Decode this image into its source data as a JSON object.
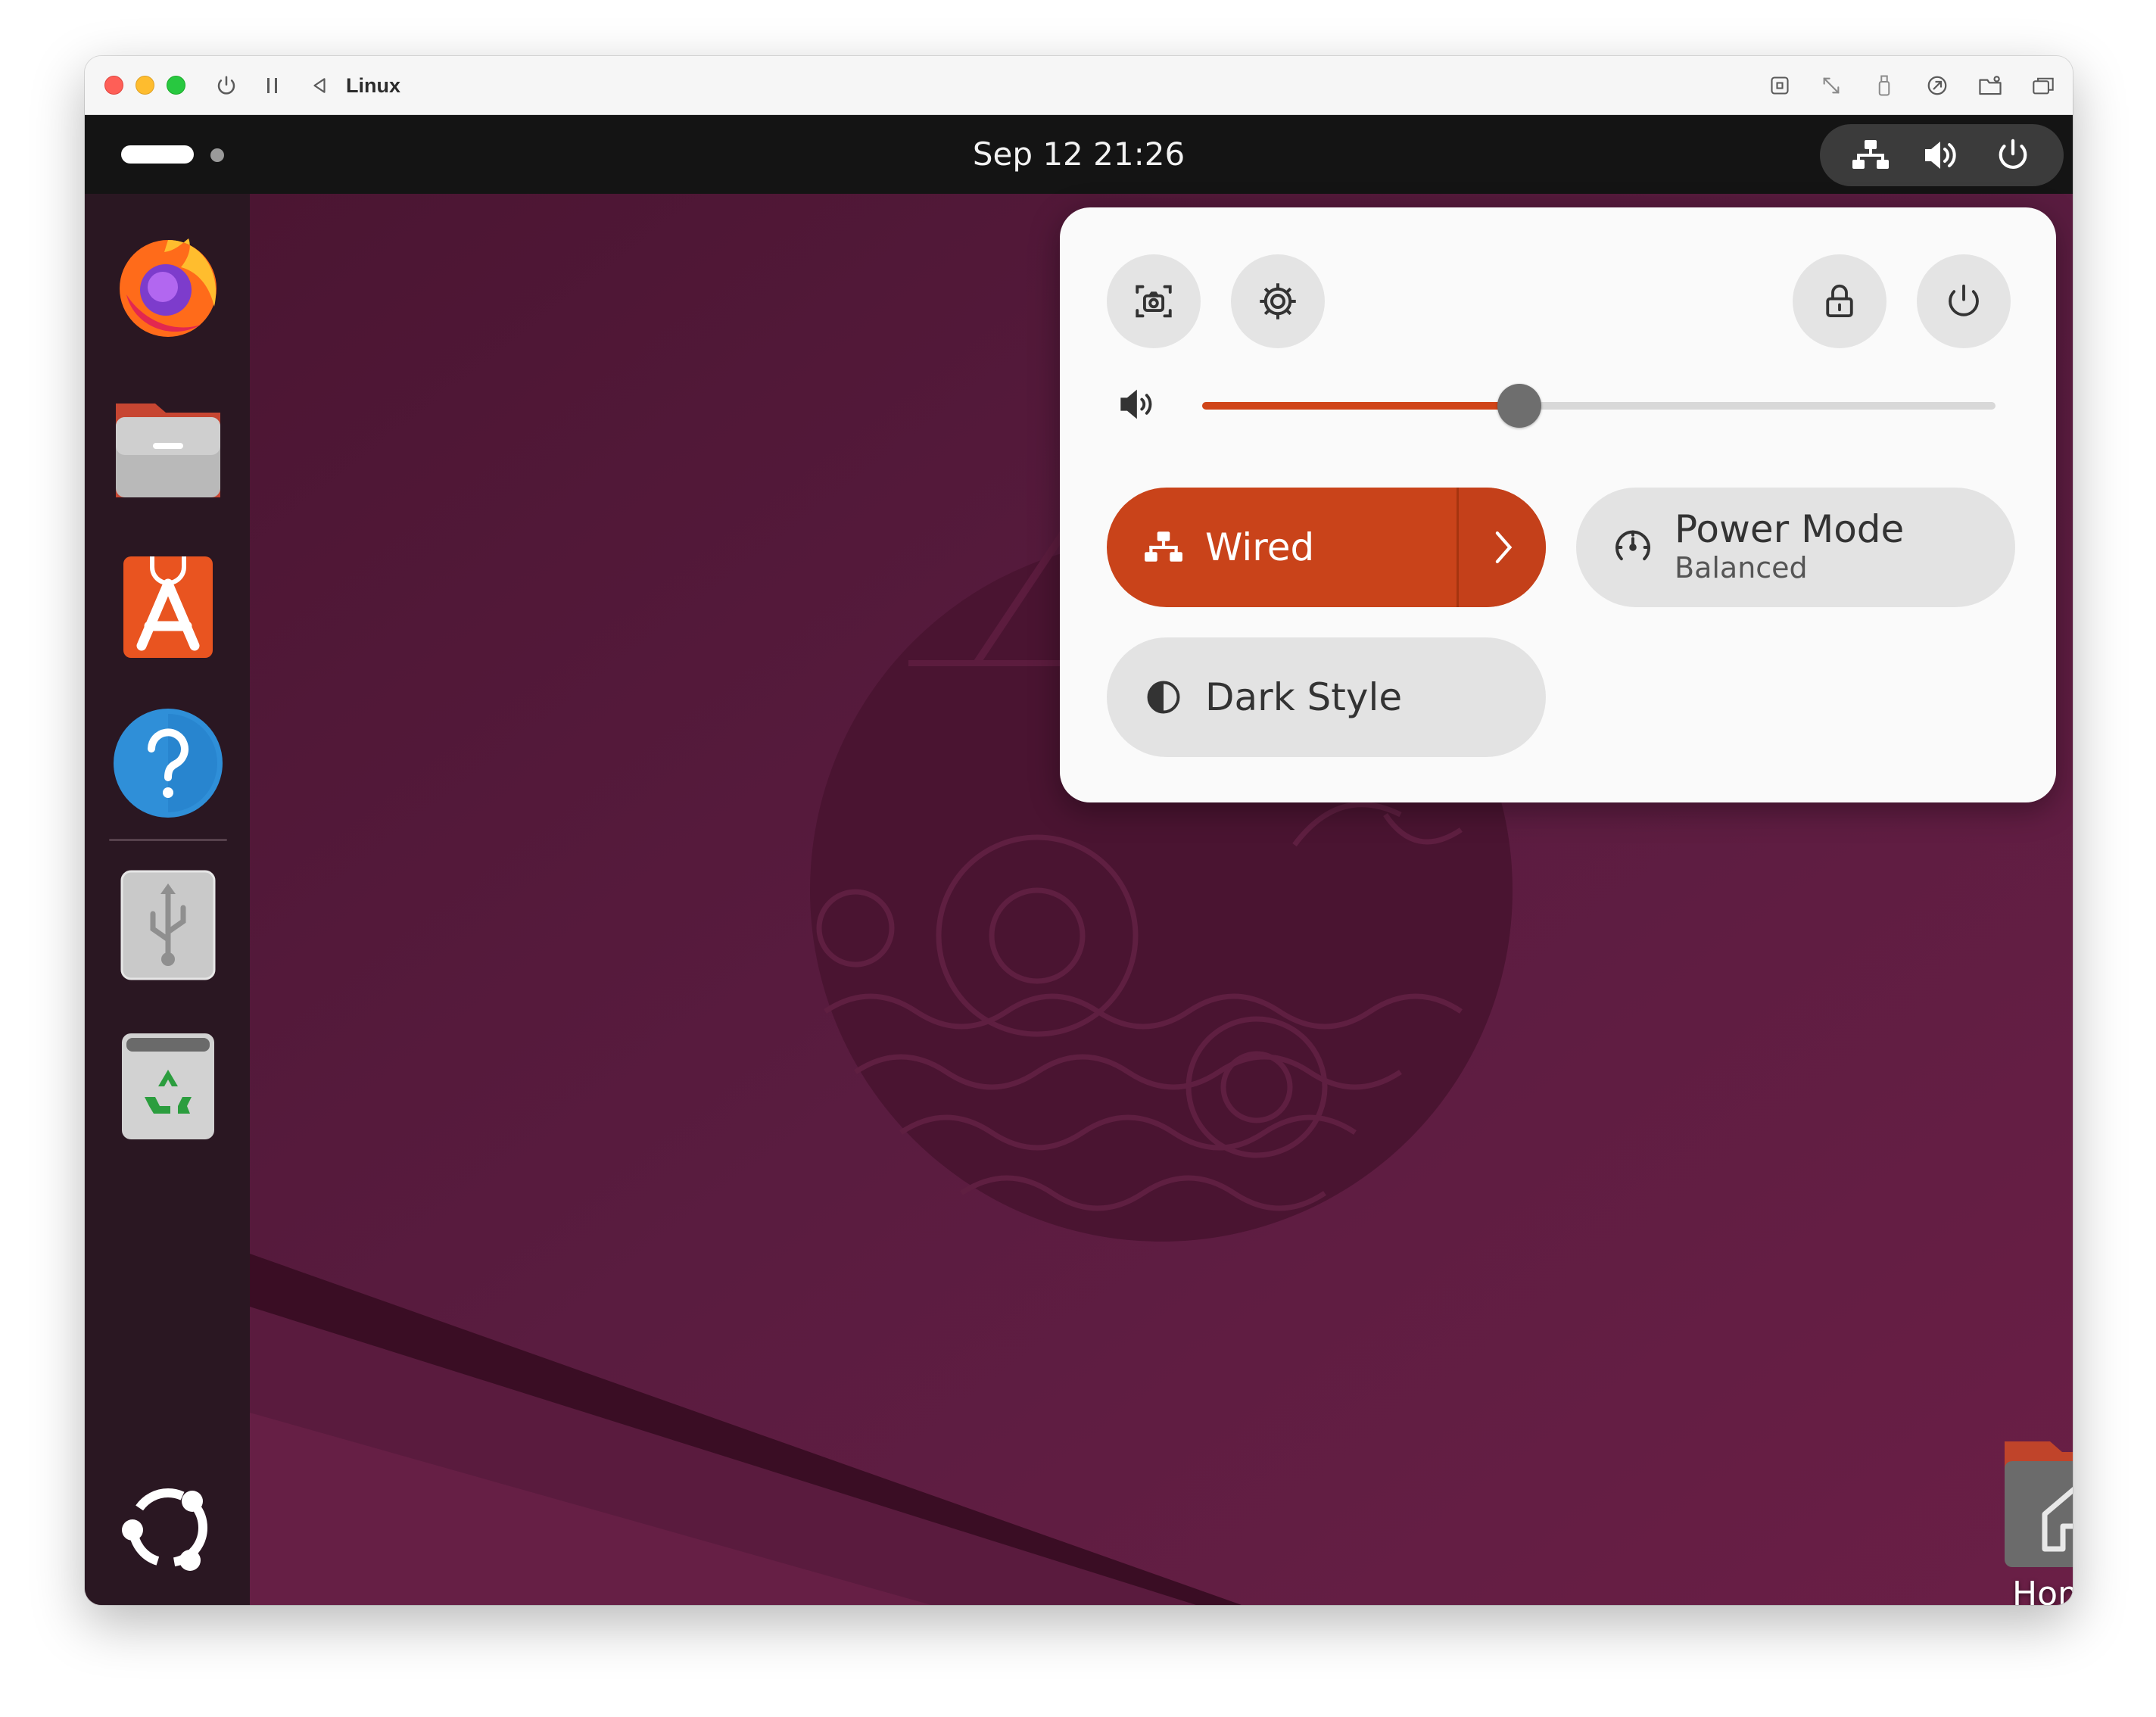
{
  "window": {
    "title": "Linux",
    "toolbar_icons": [
      "power-icon",
      "pause-icon",
      "back-icon",
      "command-icon",
      "resize-icon",
      "usb-icon",
      "network-share-icon",
      "folder-share-icon",
      "window-mode-icon"
    ]
  },
  "top_bar": {
    "clock": "Sep 12  21:26",
    "status_icons": [
      "network-wired-icon",
      "speaker-icon",
      "power-icon"
    ]
  },
  "dock": {
    "items": [
      {
        "name": "firefox",
        "icon": "firefox-icon"
      },
      {
        "name": "files",
        "icon": "files-icon"
      },
      {
        "name": "app-center",
        "icon": "app-center-icon"
      },
      {
        "name": "help",
        "icon": "help-icon"
      },
      {
        "name": "usb-drive",
        "icon": "usb-drive-icon"
      },
      {
        "name": "trash",
        "icon": "trash-icon"
      },
      {
        "name": "show-apps",
        "icon": "ubuntu-logo-icon"
      }
    ]
  },
  "desktop": {
    "home_label": "Home"
  },
  "quick_settings": {
    "buttons": [
      "screenshot-icon",
      "settings-icon",
      "lock-icon",
      "power-icon"
    ],
    "volume": {
      "level": 0.4
    },
    "toggles": {
      "wired": {
        "label": "Wired",
        "active": true
      },
      "power_mode": {
        "label": "Power Mode",
        "sublabel": "Balanced"
      },
      "dark_style": {
        "label": "Dark Style",
        "active": false
      }
    }
  },
  "colors": {
    "accent": "#c9431a",
    "top_bar": "#141414",
    "wallpaper": "#5b1c40",
    "panel": "#fafafa"
  }
}
